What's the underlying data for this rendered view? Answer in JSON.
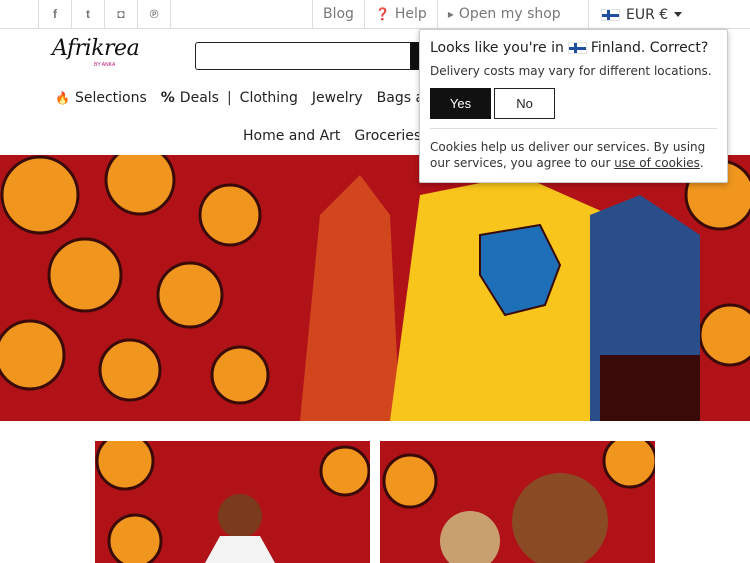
{
  "topbar": {
    "social": [
      {
        "icon": "facebook-icon",
        "glyph": "f"
      },
      {
        "icon": "twitter-icon",
        "glyph": "t"
      },
      {
        "icon": "instagram-icon",
        "glyph": "◘"
      },
      {
        "icon": "pinterest-icon",
        "glyph": "℗"
      }
    ],
    "blog": "Blog",
    "help": "Help",
    "open_shop": "Open my shop",
    "currency": "EUR €"
  },
  "header": {
    "logo_text": "Afrikrea",
    "logo_sub": "BY ANKA",
    "search_placeholder": ""
  },
  "nav": {
    "row1": {
      "selections": "Selections",
      "deals": "Deals",
      "clothing": "Clothing",
      "jewelry": "Jewelry",
      "bags": "Bags an"
    },
    "row2": {
      "home_art": "Home and Art",
      "groceries": "Groceries"
    }
  },
  "popup": {
    "question_pre": "Looks like you're in",
    "country": "Finland. Correct?",
    "delivery": "Delivery costs may vary for different locations.",
    "yes": "Yes",
    "no": "No",
    "cookies": "Cookies help us deliver our services. By using our services, you agree to our",
    "cookies_link": "use of cookies",
    "cookies_end": "."
  },
  "colors": {
    "hero_red": "#b01218",
    "flower_orange": "#f0961e",
    "dress_yellow": "#f7c51c"
  }
}
